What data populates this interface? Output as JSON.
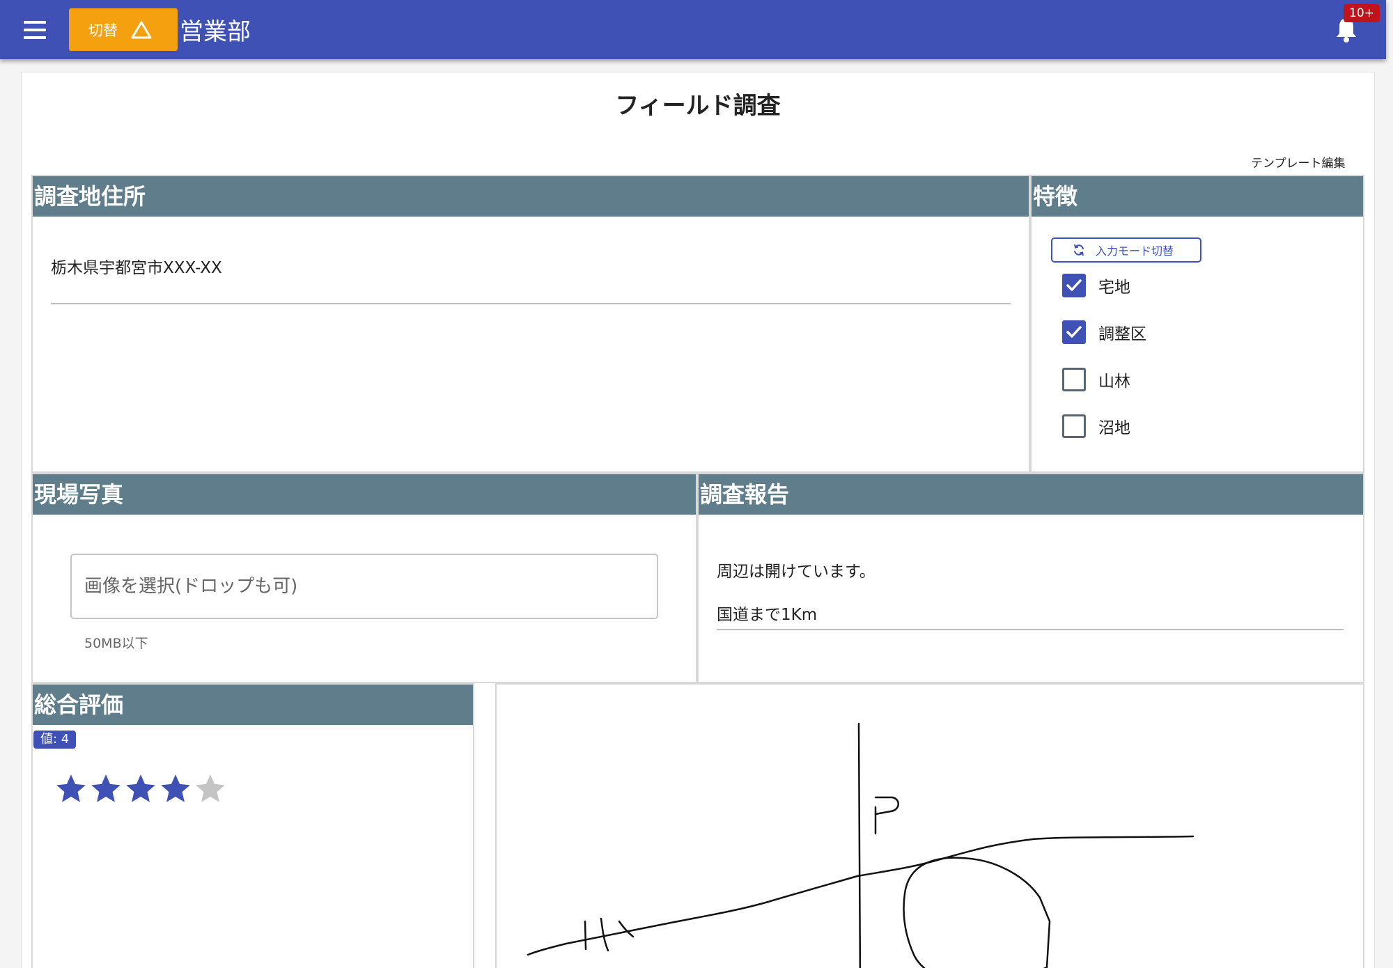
{
  "header": {
    "switch_label": "切替",
    "department": "営業部",
    "notification_count": "10+"
  },
  "page": {
    "title": "フィールド調査",
    "template_edit": "テンプレート編集"
  },
  "address_section": {
    "heading": "調査地住所",
    "value": "栃木県宇都宮市XXX-XX"
  },
  "features_section": {
    "heading": "特徴",
    "mode_button": "入力モード切替",
    "options": [
      {
        "label": "宅地",
        "checked": true
      },
      {
        "label": "調整区",
        "checked": true
      },
      {
        "label": "山林",
        "checked": false
      },
      {
        "label": "沼地",
        "checked": false
      }
    ]
  },
  "photo_section": {
    "heading": "現場写真",
    "placeholder": "画像を選択(ドロップも可)",
    "limit": "50MB以下"
  },
  "report_section": {
    "heading": "調査報告",
    "lines": [
      "周辺は開けています。",
      "国道まで1Km"
    ]
  },
  "rating_section": {
    "heading": "総合評価",
    "value_label": "値: 4",
    "rating": 4,
    "max": 5
  },
  "colors": {
    "primary": "#3f51b5",
    "accent": "#f5a00e",
    "section_header": "#607d8b",
    "badge": "#c0141d",
    "star_off": "#c4c4c4"
  }
}
